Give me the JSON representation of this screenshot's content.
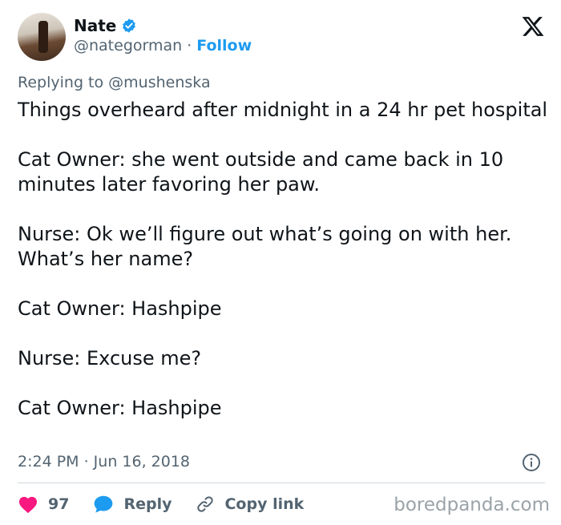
{
  "author": {
    "name": "Nate",
    "handle": "@nategorman",
    "separator": "·",
    "follow_label": "Follow"
  },
  "reply": {
    "prefix": "Replying to",
    "mention": "@mushenska"
  },
  "tweet": {
    "paragraphs": [
      "Things overheard after midnight in a 24 hr pet hospital",
      "Cat Owner: she went outside and came back in 10 minutes later favoring her paw.",
      "Nurse: Ok we’ll figure out what’s going on with her. What’s her name?",
      "Cat Owner: Hashpipe",
      "Nurse: Excuse me?",
      "Cat Owner: Hashpipe"
    ],
    "timestamp": "2:24 PM · Jun 16, 2018"
  },
  "actions": {
    "likes": "97",
    "reply_label": "Reply",
    "copy_link_label": "Copy link"
  },
  "watermark": "boredpanda.com",
  "icons": {
    "verified": "verified-badge-icon",
    "logo": "x-logo-icon",
    "info": "info-icon",
    "heart": "heart-icon",
    "reply": "reply-bubble-icon",
    "link": "link-icon"
  },
  "colors": {
    "accent": "#1d9bf0",
    "like": "#f91880",
    "muted": "#536471",
    "text": "#0f1419"
  }
}
